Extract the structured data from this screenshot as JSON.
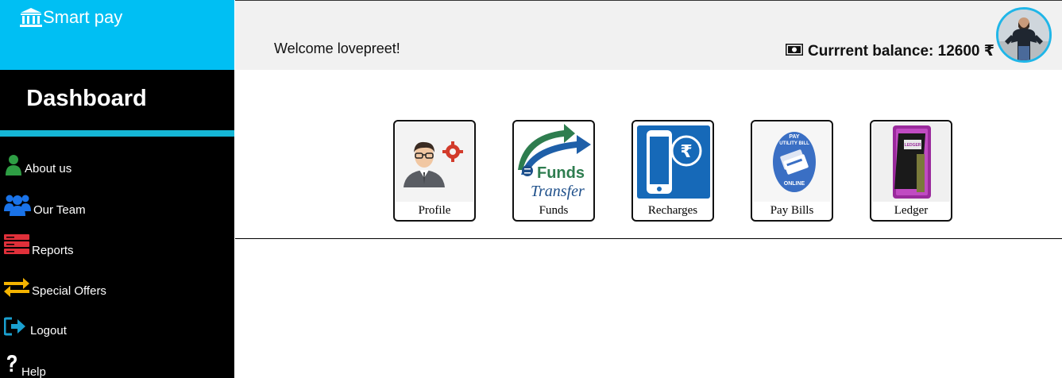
{
  "brand": {
    "name": "Smart pay",
    "icon": "bank-icon",
    "color": "#00bff3"
  },
  "sidebar": {
    "title": "Dashboard",
    "items": [
      {
        "label": "About us",
        "icon": "user-icon",
        "icon_color": "#2e9e44"
      },
      {
        "label": "Our Team",
        "icon": "users-icon",
        "icon_color": "#1a73e8"
      },
      {
        "label": "Reports",
        "icon": "server-icon",
        "icon_color": "#e0303a"
      },
      {
        "label": "Special Offers",
        "icon": "exchange-icon",
        "icon_color": "#f5b400"
      },
      {
        "label": "Logout",
        "icon": "sign-out-icon",
        "icon_color": "#1aa0d0"
      },
      {
        "label": "Help",
        "icon": "question-icon",
        "icon_color": "#ffffff"
      }
    ]
  },
  "header": {
    "welcome": "Welcome lovepreet!",
    "balance_label": "Currrent balance: 12600 ₹",
    "cash_icon": "money-icon"
  },
  "tiles": [
    {
      "label": "Profile",
      "icon": "profile-settings-icon"
    },
    {
      "label": "Funds",
      "icon": "funds-transfer-icon",
      "image_text": [
        "Funds",
        "Transfer"
      ]
    },
    {
      "label": "Recharges",
      "icon": "mobile-recharge-icon"
    },
    {
      "label": "Pay Bills",
      "icon": "pay-bills-icon",
      "image_text": [
        "PAY",
        "UTILITY BILL",
        "ONLINE"
      ]
    },
    {
      "label": "Ledger",
      "icon": "ledger-icon",
      "image_text": [
        "LEDGER"
      ]
    }
  ]
}
